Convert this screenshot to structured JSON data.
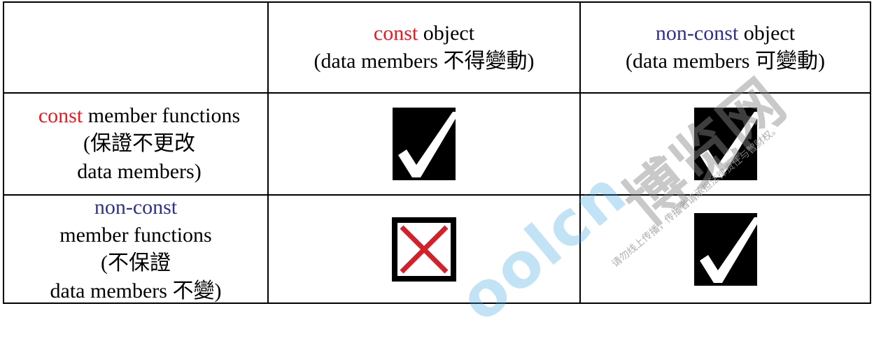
{
  "table": {
    "header": {
      "col1": {
        "red": "const",
        "rest": " object",
        "line2": "(data members 不得變動)"
      },
      "col2": {
        "blue": "non-const",
        "rest": " object",
        "line2": "(data members 可變動)"
      }
    },
    "rows": [
      {
        "label_red": "const",
        "label_rest": " member functions",
        "label_line2": "(保證不更改",
        "label_line3": "data members)",
        "cells": [
          "check-icon",
          "check-icon"
        ]
      },
      {
        "label_blue": "non-const",
        "label_line2": "member functions",
        "label_line3": "(不保證",
        "label_line4": "data members 不變)",
        "cells": [
          "cross-icon",
          "check-icon"
        ]
      }
    ]
  },
  "watermark": {
    "logo": "oolcn",
    "chinese": "博览网",
    "notice": "请勿线上传播，传播者请承担法律责任与智财权。"
  },
  "colors": {
    "keyword_const": "#e81b23",
    "keyword_nonconst": "#2e3192",
    "cross": "#d4202a",
    "watermark_logo": "#3aa6e3"
  }
}
